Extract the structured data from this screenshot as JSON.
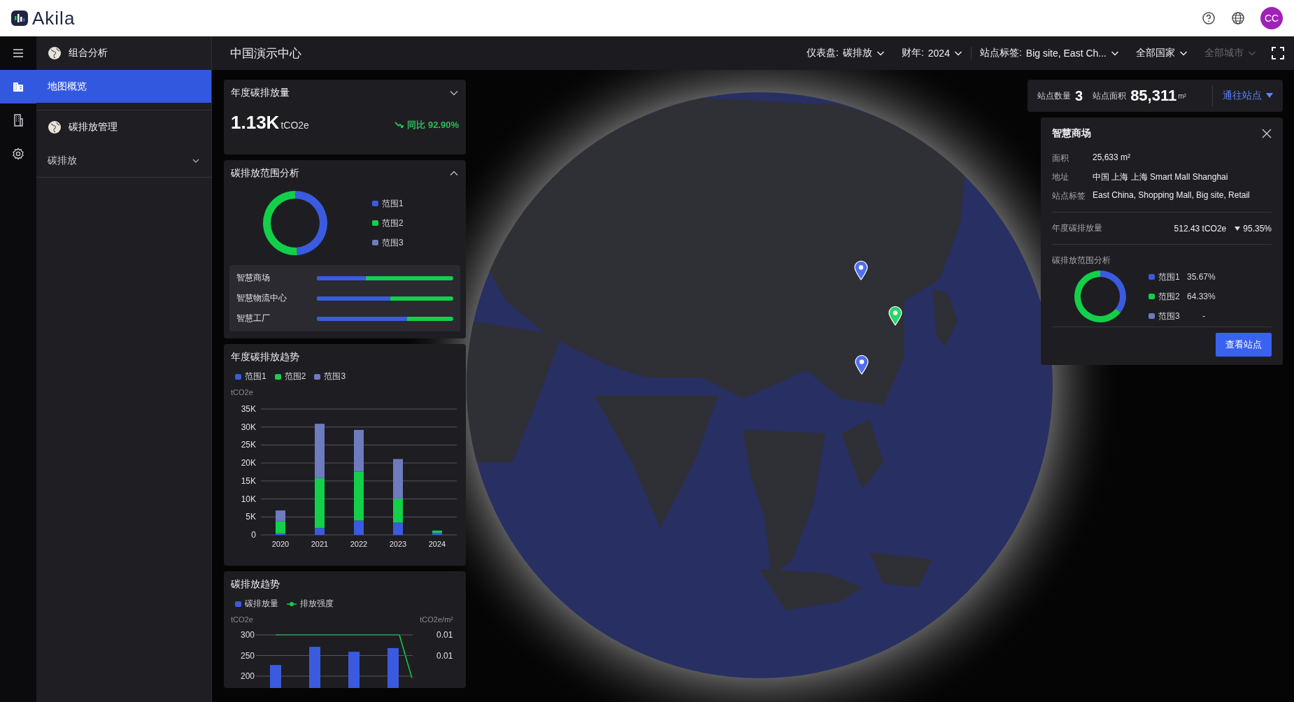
{
  "app": {
    "logo": "Akila",
    "avatar": "CC"
  },
  "rail": [
    {
      "kind": "map",
      "selected": true
    },
    {
      "kind": "report",
      "selected": false
    },
    {
      "kind": "settings",
      "selected": false
    }
  ],
  "sidebar": {
    "groups": [
      {
        "title": "组合分析",
        "items": [
          {
            "label": "地图概览",
            "selected": true
          }
        ]
      },
      {
        "title": "碳排放管理",
        "items": [
          {
            "label": "碳排放",
            "selected": false,
            "expanded": false
          }
        ]
      }
    ]
  },
  "header": {
    "title": "中国演示中心",
    "filters": [
      {
        "label": "仪表盘:",
        "value": "碳排放",
        "disabled": false
      },
      {
        "label": "财年:",
        "value": "2024",
        "disabled": false
      },
      {
        "label": "站点标签:",
        "value": "Big site, East Ch...",
        "disabled": false
      },
      {
        "value": "全部国家",
        "disabled": false
      },
      {
        "value": "全部城市",
        "disabled": true
      }
    ]
  },
  "summary": {
    "title": "年度碳排放量",
    "expanded": false,
    "value": "1.13K",
    "unit": "tCO2e",
    "decreasing": true,
    "change": "同比 92.90%"
  },
  "scope_panel": {
    "title": "碳排放范围分析",
    "expanded": true,
    "legend": [
      {
        "color": "#3a5be0"
      },
      {
        "color": "#13cf4a"
      },
      {
        "color": "#6e7bbf"
      }
    ],
    "chart_data": {
      "type": "donut",
      "categories": [
        "范围1",
        "范围2",
        "范围3"
      ],
      "values": [
        49,
        51,
        0
      ]
    },
    "sites": [
      {
        "name": "智慧商场",
        "level": 0.36
      },
      {
        "name": "智慧物流中心",
        "level": 0.54
      },
      {
        "name": "智慧工厂",
        "level": 0.66
      }
    ]
  },
  "annual_trend": {
    "title": "年度碳排放趋势",
    "chart_data": {
      "type": "bar",
      "stacked": true,
      "grid": true,
      "ylabel": "tCO2e",
      "categories": [
        "2020",
        "2021",
        "2022",
        "2023",
        "2024"
      ],
      "ylim": [
        0,
        35000
      ],
      "yticks": [
        {
          "value": 0,
          "label": "0"
        },
        {
          "value": 5000,
          "label": "5K"
        },
        {
          "value": 10000,
          "label": "10K"
        },
        {
          "value": 15000,
          "label": "15K"
        },
        {
          "value": 20000,
          "label": "20K"
        },
        {
          "value": 25000,
          "label": "25K"
        },
        {
          "value": 30000,
          "label": "30K"
        },
        {
          "value": 35000,
          "label": "35K"
        }
      ],
      "series": [
        {
          "name": "范围1",
          "color": "#3a5be0",
          "values": [
            400,
            1900,
            4000,
            3400,
            600
          ]
        },
        {
          "name": "范围2",
          "color": "#13cf4a",
          "values": [
            3400,
            13900,
            13600,
            6700,
            600
          ]
        },
        {
          "name": "范围3",
          "color": "#6e7bbf",
          "values": [
            3000,
            15100,
            11600,
            11000,
            0
          ]
        }
      ]
    }
  },
  "trend": {
    "title": "碳排放趋势",
    "line_legend": {
      "name": "排放强度",
      "color": "#13cf4a"
    },
    "right_axis": {
      "title": "tCO2e/m²",
      "ticks": [
        "0.01",
        "0.01"
      ]
    },
    "chart_data": {
      "type": "bar",
      "grid": true,
      "ylabel": "tCO2e",
      "ylim": [
        0,
        300
      ],
      "yticks": [
        {
          "value": 200,
          "label": "200"
        },
        {
          "value": 250,
          "label": "250"
        },
        {
          "value": 300,
          "label": "300"
        }
      ],
      "series": [
        {
          "name": "碳排放量",
          "color": "#3a5be0",
          "values": [
            227,
            271,
            259,
            268
          ]
        }
      ]
    }
  },
  "stats": {
    "count_label": "站点数量",
    "count": "3",
    "area_label": "站点面积",
    "area": "85,311",
    "area_unit": "m²",
    "goto": "通往站点"
  },
  "site_card": {
    "title": "智慧商场",
    "fields": [
      {
        "label": "面积",
        "value": "25,633 m²"
      },
      {
        "label": "地址",
        "value": "中国 上海 上海 Smart Mall Shanghai"
      },
      {
        "label": "站点标签",
        "value": "East China, Shopping Mall, Big site, Retail"
      }
    ],
    "annual_label": "年度碳排放量",
    "annual_value": "512.43 tCO2e",
    "decreasing": true,
    "annual_change": "95.35%",
    "scope_title": "碳排放范围分析",
    "legend": [
      {
        "color": "#3a5be0"
      },
      {
        "color": "#13cf4a"
      },
      {
        "color": "#6e7bbf"
      }
    ],
    "chart_data": {
      "type": "donut",
      "categories": [
        "范围1",
        "范围2",
        "范围3"
      ],
      "values": [
        35.67,
        64.33,
        0
      ],
      "value_labels": [
        "35.67%",
        "64.33%",
        "-"
      ]
    },
    "button": "查看站点"
  },
  "map": {
    "kind": "picture",
    "pins": [
      {
        "selected": false
      },
      {
        "selected": true
      },
      {
        "selected": false
      }
    ]
  }
}
